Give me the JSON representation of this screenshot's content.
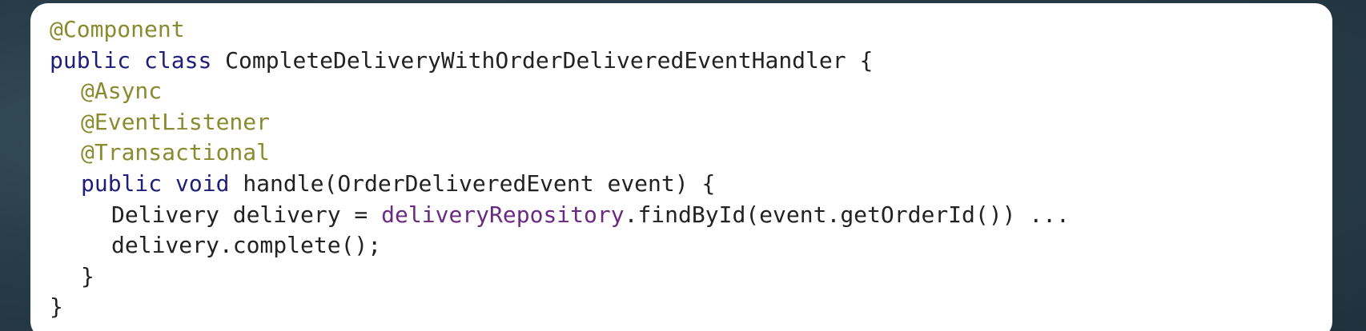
{
  "code": {
    "line1": {
      "annotation": "@Component"
    },
    "line2": {
      "kw1": "public",
      "kw2": "class",
      "name": "CompleteDeliveryWithOrderDeliveredEventHandler",
      "rest": "{"
    },
    "line3": {
      "annotation": "@Async"
    },
    "line4": {
      "annotation": "@EventListener"
    },
    "line5": {
      "annotation": "@Transactional"
    },
    "line6": {
      "kw1": "public",
      "kw2": "void",
      "rest": "handle(OrderDeliveredEvent event) {"
    },
    "line7": {
      "pre": "Delivery delivery = ",
      "field": "deliveryRepository",
      "post": ".findById(event.getOrderId()) ..."
    },
    "line8": {
      "text": "delivery.complete();"
    },
    "line9": {
      "text": "}"
    },
    "line10": {
      "text": "}"
    }
  },
  "colors": {
    "annotation": "#8a8a2e",
    "keyword": "#1f1f7a",
    "field": "#6b2a82",
    "text": "#222222",
    "background": "#2a3f4b",
    "card": "#ffffff"
  }
}
